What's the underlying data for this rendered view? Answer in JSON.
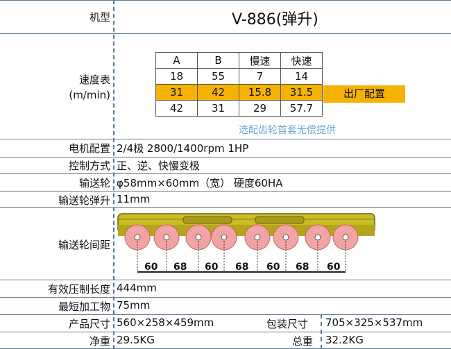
{
  "model": {
    "label": "机型",
    "value": "V-886(弹升)"
  },
  "speed": {
    "label": "速度表",
    "unit": "(m/min)",
    "headers": [
      "A",
      "B",
      "慢速",
      "快速"
    ],
    "rows": [
      [
        "18",
        "55",
        "7",
        "14"
      ],
      [
        "31",
        "42",
        "15.8",
        "31.5"
      ],
      [
        "42",
        "31",
        "29",
        "57.7"
      ]
    ],
    "highlight_row": 1,
    "factory_label": "出厂配置",
    "note": "选配齿轮首套无偿提供",
    "highlight_color": "#f5b200"
  },
  "motor": {
    "label": "电机配置",
    "value": "2/4极 2800/1400rpm 1HP"
  },
  "control": {
    "label": "控制方式",
    "value": "正、逆、快慢变极"
  },
  "wheel": {
    "label": "输送轮",
    "value": "φ58mm×60mm（宽）  硬度60HA"
  },
  "lift": {
    "label": "输送轮弹升",
    "value": "11mm"
  },
  "spacing": {
    "label": "输送轮间距",
    "dims": [
      "60",
      "68",
      "60",
      "68",
      "60",
      "68",
      "60"
    ]
  },
  "effective": {
    "label": "有效压制长度",
    "value": "444mm"
  },
  "shortest": {
    "label": "最短加工物",
    "value": "75mm"
  },
  "product_size": {
    "label": "产品尺寸",
    "value": "560×258×459mm"
  },
  "package_size": {
    "label": "包装尺寸",
    "value": "705×325×537mm"
  },
  "net_weight": {
    "label": "净重",
    "value": "29.5KG"
  },
  "gross_weight": {
    "label": "总重",
    "value": "32.2KG"
  }
}
